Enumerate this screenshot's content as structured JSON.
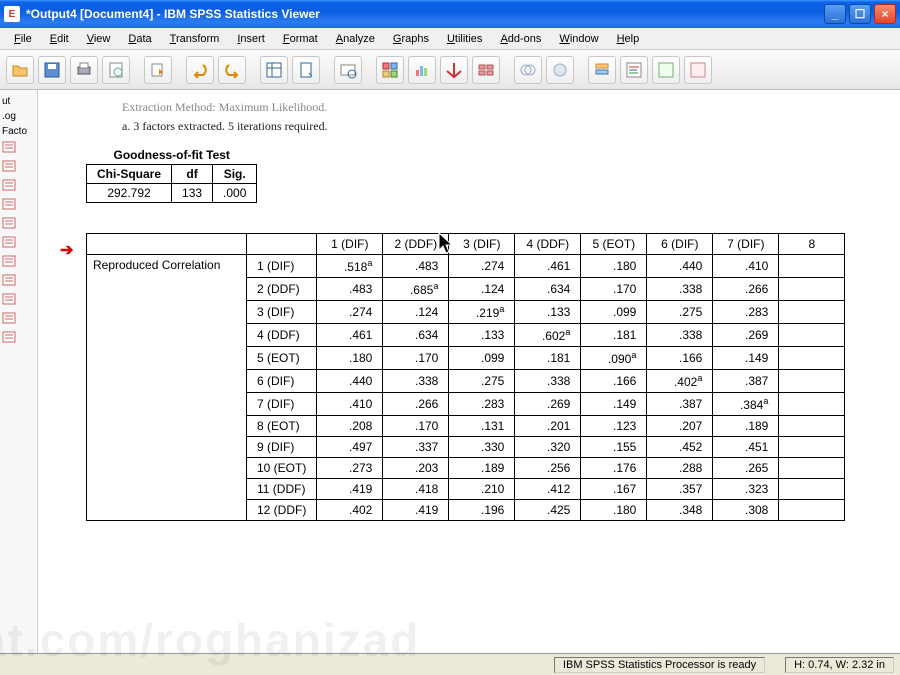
{
  "window": {
    "title": "*Output4 [Document4] - IBM SPSS Statistics Viewer"
  },
  "menu": [
    "File",
    "Edit",
    "View",
    "Data",
    "Transform",
    "Insert",
    "Format",
    "Analyze",
    "Graphs",
    "Utilities",
    "Add-ons",
    "Window",
    "Help"
  ],
  "extraction_text": "Extraction Method: Maximum Likelihood.",
  "footnote_text": "a. 3 factors extracted. 5 iterations required.",
  "gof": {
    "title": "Goodness-of-fit Test",
    "headers": [
      "Chi-Square",
      "df",
      "Sig."
    ],
    "values": [
      "292.792",
      "133",
      ".000"
    ]
  },
  "repro": {
    "row_header": "Reproduced Correlation",
    "cols": [
      "1 (DIF)",
      "2 (DDF)",
      "3 (DIF)",
      "4 (DDF)",
      "5 (EOT)",
      "6 (DIF)",
      "7 (DIF)",
      "8"
    ],
    "rows": [
      {
        "label": "1 (DIF)",
        "vals": [
          ".518ᵃ",
          ".483",
          ".274",
          ".461",
          ".180",
          ".440",
          ".410"
        ]
      },
      {
        "label": "2 (DDF)",
        "vals": [
          ".483",
          ".685ᵃ",
          ".124",
          ".634",
          ".170",
          ".338",
          ".266"
        ]
      },
      {
        "label": "3 (DIF)",
        "vals": [
          ".274",
          ".124",
          ".219ᵃ",
          ".133",
          ".099",
          ".275",
          ".283"
        ]
      },
      {
        "label": "4 (DDF)",
        "vals": [
          ".461",
          ".634",
          ".133",
          ".602ᵃ",
          ".181",
          ".338",
          ".269"
        ]
      },
      {
        "label": "5 (EOT)",
        "vals": [
          ".180",
          ".170",
          ".099",
          ".181",
          ".090ᵃ",
          ".166",
          ".149"
        ]
      },
      {
        "label": "6 (DIF)",
        "vals": [
          ".440",
          ".338",
          ".275",
          ".338",
          ".166",
          ".402ᵃ",
          ".387"
        ]
      },
      {
        "label": "7 (DIF)",
        "vals": [
          ".410",
          ".266",
          ".283",
          ".269",
          ".149",
          ".387",
          ".384ᵃ"
        ]
      },
      {
        "label": "8 (EOT)",
        "vals": [
          ".208",
          ".170",
          ".131",
          ".201",
          ".123",
          ".207",
          ".189"
        ]
      },
      {
        "label": "9 (DIF)",
        "vals": [
          ".497",
          ".337",
          ".330",
          ".320",
          ".155",
          ".452",
          ".451"
        ]
      },
      {
        "label": "10 (EOT)",
        "vals": [
          ".273",
          ".203",
          ".189",
          ".256",
          ".176",
          ".288",
          ".265"
        ]
      },
      {
        "label": "11 (DDF)",
        "vals": [
          ".419",
          ".418",
          ".210",
          ".412",
          ".167",
          ".357",
          ".323"
        ]
      },
      {
        "label": "12 (DDF)",
        "vals": [
          ".402",
          ".419",
          ".196",
          ".425",
          ".180",
          ".348",
          ".308"
        ]
      }
    ]
  },
  "status": {
    "processor": "IBM SPSS Statistics Processor is ready",
    "dims": "H: 0.74, W: 2.32 in"
  },
  "outline": [
    "ut",
    ".og",
    "Facto"
  ],
  "watermark": "rat.com/roghanizad"
}
